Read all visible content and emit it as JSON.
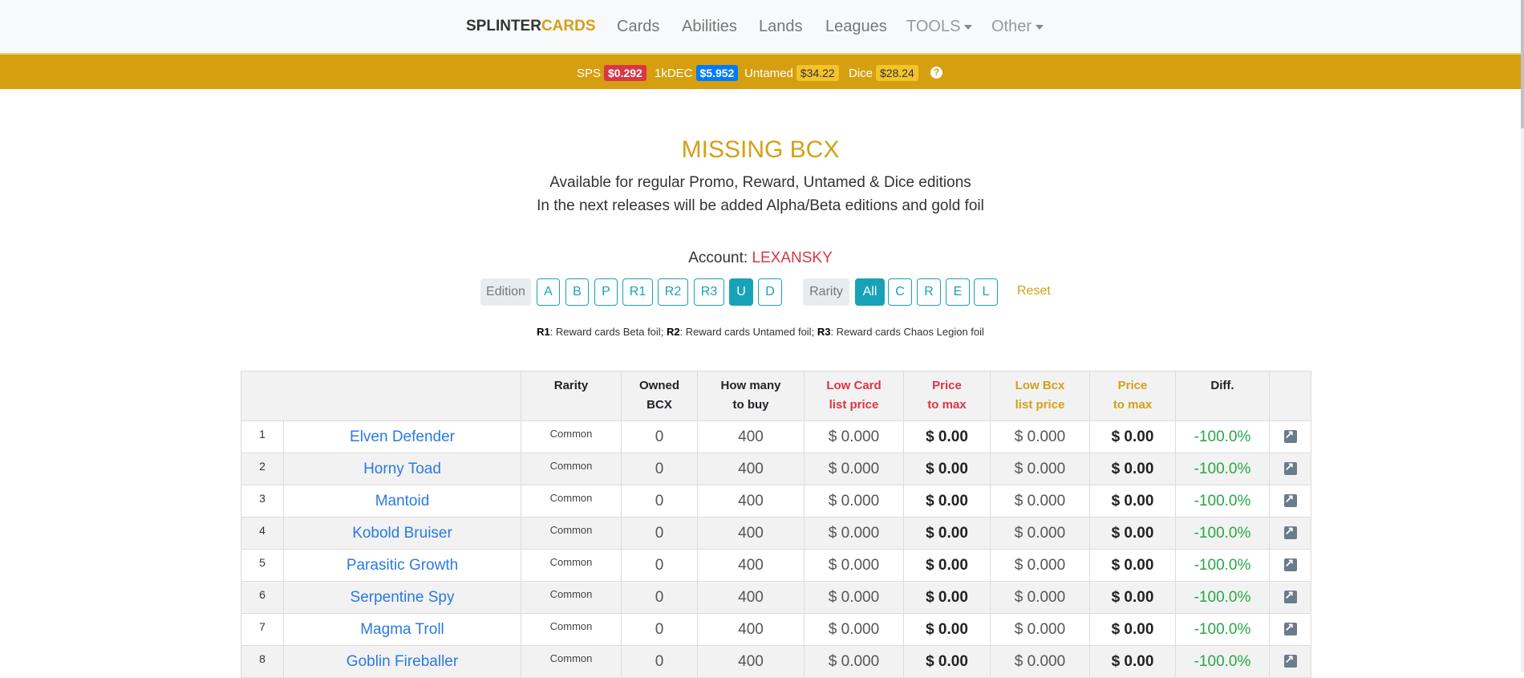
{
  "nav": {
    "brand_a": "SPLINTER",
    "brand_b": "CARDS",
    "items": [
      "Cards",
      "Abilities",
      "Lands",
      "Leagues"
    ],
    "tools": "TOOLS",
    "other": "Other"
  },
  "prices": {
    "sps_label": "SPS",
    "sps_value": "$0.292",
    "dec_label": "1kDEC",
    "dec_value": "$5.952",
    "untamed_label": "Untamed",
    "untamed_value": "$34.22",
    "dice_label": "Dice",
    "dice_value": "$28.24",
    "help": "?"
  },
  "page": {
    "title": "MISSING BCX",
    "subtitle1": "Available for regular Promo, Reward, Untamed & Dice editions",
    "subtitle2": "In the next releases will be added Alpha/Beta editions and gold foil",
    "account_label": "Account:",
    "account_name": "LEXANSKY"
  },
  "filters": {
    "edition_label": "Edition",
    "editions": [
      "A",
      "B",
      "P",
      "R1",
      "R2",
      "R3",
      "U",
      "D"
    ],
    "edition_active": "U",
    "rarity_label": "Rarity",
    "rarities": [
      "All",
      "C",
      "R",
      "E",
      "L"
    ],
    "rarity_active": "All",
    "reset": "Reset"
  },
  "legend": {
    "r1_key": "R1",
    "r1_text": ": Reward cards Beta foil;",
    "r2_key": "R2",
    "r2_text": ": Reward cards Untamed foil;",
    "r3_key": "R3",
    "r3_text": ": Reward cards Chaos Legion foil"
  },
  "table": {
    "headers": {
      "rarity": "Rarity",
      "owned_1": "Owned",
      "owned_2": "BCX",
      "howmany_1": "How many",
      "howmany_2": "to buy",
      "lowcard_1": "Low Card",
      "lowcard_2": "list price",
      "price1_1": "Price",
      "price1_2": "to max",
      "lowbcx_1": "Low Bcx",
      "lowbcx_2": "list price",
      "price2_1": "Price",
      "price2_2": "to max",
      "diff": "Diff."
    },
    "rows": [
      {
        "n": "1",
        "name": "Elven Defender",
        "rarity": "Common",
        "owned": "0",
        "buy": "400",
        "low_card": "$ 0.000",
        "price_max": "$ 0.00",
        "low_bcx": "$ 0.000",
        "price_max2": "$ 0.00",
        "diff": "-100.0%"
      },
      {
        "n": "2",
        "name": "Horny Toad",
        "rarity": "Common",
        "owned": "0",
        "buy": "400",
        "low_card": "$ 0.000",
        "price_max": "$ 0.00",
        "low_bcx": "$ 0.000",
        "price_max2": "$ 0.00",
        "diff": "-100.0%"
      },
      {
        "n": "3",
        "name": "Mantoid",
        "rarity": "Common",
        "owned": "0",
        "buy": "400",
        "low_card": "$ 0.000",
        "price_max": "$ 0.00",
        "low_bcx": "$ 0.000",
        "price_max2": "$ 0.00",
        "diff": "-100.0%"
      },
      {
        "n": "4",
        "name": "Kobold Bruiser",
        "rarity": "Common",
        "owned": "0",
        "buy": "400",
        "low_card": "$ 0.000",
        "price_max": "$ 0.00",
        "low_bcx": "$ 0.000",
        "price_max2": "$ 0.00",
        "diff": "-100.0%"
      },
      {
        "n": "5",
        "name": "Parasitic Growth",
        "rarity": "Common",
        "owned": "0",
        "buy": "400",
        "low_card": "$ 0.000",
        "price_max": "$ 0.00",
        "low_bcx": "$ 0.000",
        "price_max2": "$ 0.00",
        "diff": "-100.0%"
      },
      {
        "n": "6",
        "name": "Serpentine Spy",
        "rarity": "Common",
        "owned": "0",
        "buy": "400",
        "low_card": "$ 0.000",
        "price_max": "$ 0.00",
        "low_bcx": "$ 0.000",
        "price_max2": "$ 0.00",
        "diff": "-100.0%"
      },
      {
        "n": "7",
        "name": "Magma Troll",
        "rarity": "Common",
        "owned": "0",
        "buy": "400",
        "low_card": "$ 0.000",
        "price_max": "$ 0.00",
        "low_bcx": "$ 0.000",
        "price_max2": "$ 0.00",
        "diff": "-100.0%"
      },
      {
        "n": "8",
        "name": "Goblin Fireballer",
        "rarity": "Common",
        "owned": "0",
        "buy": "400",
        "low_card": "$ 0.000",
        "price_max": "$ 0.00",
        "low_bcx": "$ 0.000",
        "price_max2": "$ 0.00",
        "diff": "-100.0%"
      }
    ]
  },
  "colors": {
    "accent_gold": "#d4a017",
    "price_bar": "#d59f0f",
    "teal": "#17a2b8",
    "red": "#dc3545",
    "green": "#28a745",
    "link_blue": "#2a7ae2"
  }
}
